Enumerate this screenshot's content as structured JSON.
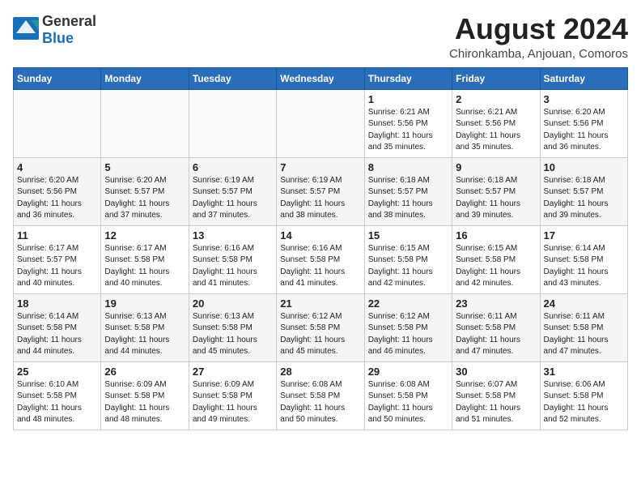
{
  "header": {
    "logo_general": "General",
    "logo_blue": "Blue",
    "month_year": "August 2024",
    "location": "Chironkamba, Anjouan, Comoros"
  },
  "weekdays": [
    "Sunday",
    "Monday",
    "Tuesday",
    "Wednesday",
    "Thursday",
    "Friday",
    "Saturday"
  ],
  "weeks": [
    [
      {
        "day": "",
        "content": ""
      },
      {
        "day": "",
        "content": ""
      },
      {
        "day": "",
        "content": ""
      },
      {
        "day": "",
        "content": ""
      },
      {
        "day": "1",
        "content": "Sunrise: 6:21 AM\nSunset: 5:56 PM\nDaylight: 11 hours\nand 35 minutes."
      },
      {
        "day": "2",
        "content": "Sunrise: 6:21 AM\nSunset: 5:56 PM\nDaylight: 11 hours\nand 35 minutes."
      },
      {
        "day": "3",
        "content": "Sunrise: 6:20 AM\nSunset: 5:56 PM\nDaylight: 11 hours\nand 36 minutes."
      }
    ],
    [
      {
        "day": "4",
        "content": "Sunrise: 6:20 AM\nSunset: 5:56 PM\nDaylight: 11 hours\nand 36 minutes."
      },
      {
        "day": "5",
        "content": "Sunrise: 6:20 AM\nSunset: 5:57 PM\nDaylight: 11 hours\nand 37 minutes."
      },
      {
        "day": "6",
        "content": "Sunrise: 6:19 AM\nSunset: 5:57 PM\nDaylight: 11 hours\nand 37 minutes."
      },
      {
        "day": "7",
        "content": "Sunrise: 6:19 AM\nSunset: 5:57 PM\nDaylight: 11 hours\nand 38 minutes."
      },
      {
        "day": "8",
        "content": "Sunrise: 6:18 AM\nSunset: 5:57 PM\nDaylight: 11 hours\nand 38 minutes."
      },
      {
        "day": "9",
        "content": "Sunrise: 6:18 AM\nSunset: 5:57 PM\nDaylight: 11 hours\nand 39 minutes."
      },
      {
        "day": "10",
        "content": "Sunrise: 6:18 AM\nSunset: 5:57 PM\nDaylight: 11 hours\nand 39 minutes."
      }
    ],
    [
      {
        "day": "11",
        "content": "Sunrise: 6:17 AM\nSunset: 5:57 PM\nDaylight: 11 hours\nand 40 minutes."
      },
      {
        "day": "12",
        "content": "Sunrise: 6:17 AM\nSunset: 5:58 PM\nDaylight: 11 hours\nand 40 minutes."
      },
      {
        "day": "13",
        "content": "Sunrise: 6:16 AM\nSunset: 5:58 PM\nDaylight: 11 hours\nand 41 minutes."
      },
      {
        "day": "14",
        "content": "Sunrise: 6:16 AM\nSunset: 5:58 PM\nDaylight: 11 hours\nand 41 minutes."
      },
      {
        "day": "15",
        "content": "Sunrise: 6:15 AM\nSunset: 5:58 PM\nDaylight: 11 hours\nand 42 minutes."
      },
      {
        "day": "16",
        "content": "Sunrise: 6:15 AM\nSunset: 5:58 PM\nDaylight: 11 hours\nand 42 minutes."
      },
      {
        "day": "17",
        "content": "Sunrise: 6:14 AM\nSunset: 5:58 PM\nDaylight: 11 hours\nand 43 minutes."
      }
    ],
    [
      {
        "day": "18",
        "content": "Sunrise: 6:14 AM\nSunset: 5:58 PM\nDaylight: 11 hours\nand 44 minutes."
      },
      {
        "day": "19",
        "content": "Sunrise: 6:13 AM\nSunset: 5:58 PM\nDaylight: 11 hours\nand 44 minutes."
      },
      {
        "day": "20",
        "content": "Sunrise: 6:13 AM\nSunset: 5:58 PM\nDaylight: 11 hours\nand 45 minutes."
      },
      {
        "day": "21",
        "content": "Sunrise: 6:12 AM\nSunset: 5:58 PM\nDaylight: 11 hours\nand 45 minutes."
      },
      {
        "day": "22",
        "content": "Sunrise: 6:12 AM\nSunset: 5:58 PM\nDaylight: 11 hours\nand 46 minutes."
      },
      {
        "day": "23",
        "content": "Sunrise: 6:11 AM\nSunset: 5:58 PM\nDaylight: 11 hours\nand 47 minutes."
      },
      {
        "day": "24",
        "content": "Sunrise: 6:11 AM\nSunset: 5:58 PM\nDaylight: 11 hours\nand 47 minutes."
      }
    ],
    [
      {
        "day": "25",
        "content": "Sunrise: 6:10 AM\nSunset: 5:58 PM\nDaylight: 11 hours\nand 48 minutes."
      },
      {
        "day": "26",
        "content": "Sunrise: 6:09 AM\nSunset: 5:58 PM\nDaylight: 11 hours\nand 48 minutes."
      },
      {
        "day": "27",
        "content": "Sunrise: 6:09 AM\nSunset: 5:58 PM\nDaylight: 11 hours\nand 49 minutes."
      },
      {
        "day": "28",
        "content": "Sunrise: 6:08 AM\nSunset: 5:58 PM\nDaylight: 11 hours\nand 50 minutes."
      },
      {
        "day": "29",
        "content": "Sunrise: 6:08 AM\nSunset: 5:58 PM\nDaylight: 11 hours\nand 50 minutes."
      },
      {
        "day": "30",
        "content": "Sunrise: 6:07 AM\nSunset: 5:58 PM\nDaylight: 11 hours\nand 51 minutes."
      },
      {
        "day": "31",
        "content": "Sunrise: 6:06 AM\nSunset: 5:58 PM\nDaylight: 11 hours\nand 52 minutes."
      }
    ]
  ]
}
